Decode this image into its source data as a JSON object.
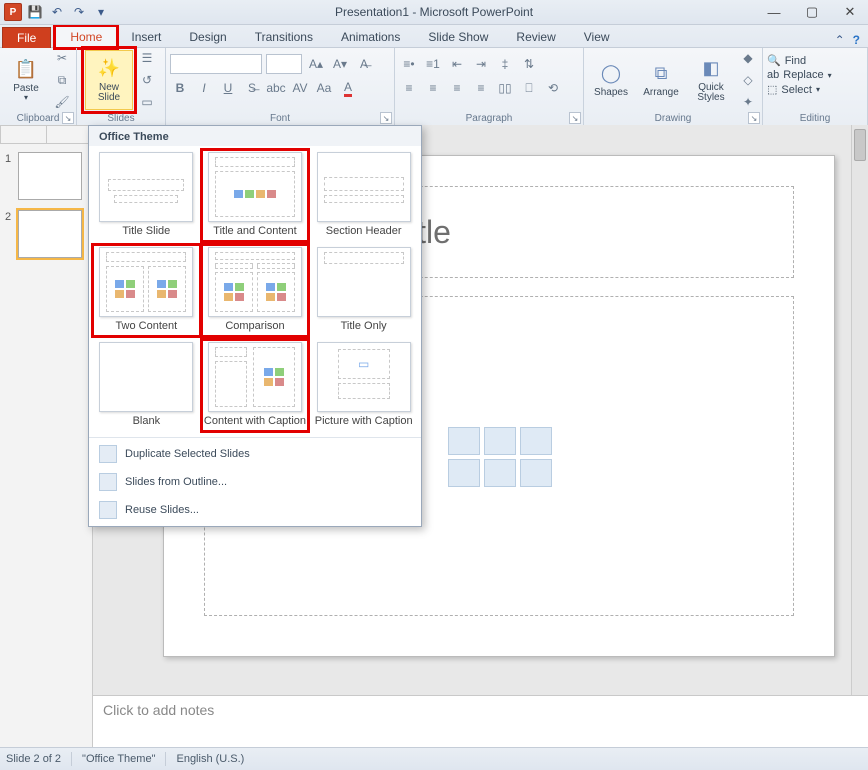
{
  "window": {
    "title": "Presentation1 - Microsoft PowerPoint"
  },
  "ribbon": {
    "file": "File",
    "tabs": [
      "Home",
      "Insert",
      "Design",
      "Transitions",
      "Animations",
      "Slide Show",
      "Review",
      "View"
    ],
    "active_tab": "Home",
    "groups": {
      "clipboard": {
        "label": "Clipboard",
        "paste": "Paste"
      },
      "slides": {
        "label": "Slides",
        "newslide": "New\nSlide"
      },
      "font": {
        "label": "Font"
      },
      "paragraph": {
        "label": "Paragraph"
      },
      "drawing": {
        "label": "Drawing",
        "shapes": "Shapes",
        "arrange": "Arrange",
        "quickstyles": "Quick Styles"
      },
      "editing": {
        "label": "Editing",
        "find": "Find",
        "replace": "Replace",
        "select": "Select"
      }
    }
  },
  "gallery": {
    "header": "Office Theme",
    "items": [
      {
        "label": "Title Slide",
        "red": false
      },
      {
        "label": "Title and Content",
        "red": true
      },
      {
        "label": "Section Header",
        "red": false
      },
      {
        "label": "Two Content",
        "red": true
      },
      {
        "label": "Comparison",
        "red": true
      },
      {
        "label": "Title Only",
        "red": false
      },
      {
        "label": "Blank",
        "red": false
      },
      {
        "label": "Content with Caption",
        "red": true
      },
      {
        "label": "Picture with Caption",
        "red": false
      }
    ],
    "footer": [
      "Duplicate Selected Slides",
      "Slides from Outline...",
      "Reuse Slides..."
    ]
  },
  "slide": {
    "title_placeholder": "Click to add title",
    "notes_placeholder": "Click to add notes"
  },
  "thumbs": {
    "count": 2,
    "selected": 2,
    "numbers": [
      "1",
      "2"
    ]
  },
  "status": {
    "slide": "Slide 2 of 2",
    "theme": "\"Office Theme\"",
    "lang": "English (U.S.)"
  }
}
